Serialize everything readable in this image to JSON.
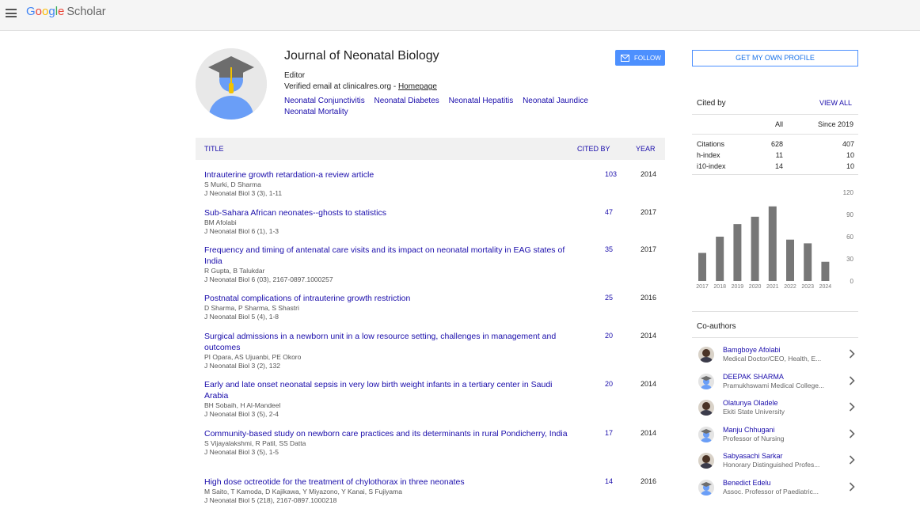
{
  "header": {
    "logo_google": "Google",
    "logo_scholar": "Scholar"
  },
  "profile": {
    "name": "Journal of Neonatal Biology",
    "affiliation": "Editor",
    "email": "Verified email at clinicalres.org - ",
    "homepage": "Homepage",
    "interests": [
      "Neonatal Conjunctivitis",
      "Neonatal Diabetes",
      "Neonatal Hepatitis",
      "Neonatal Jaundice",
      "Neonatal Mortality"
    ],
    "follow_label": "FOLLOW"
  },
  "table": {
    "col_title": "TITLE",
    "col_cited": "CITED BY",
    "col_year": "YEAR",
    "rows": [
      {
        "title": "Intrauterine growth retardation-a review article",
        "authors": "S Murki, D Sharma",
        "venue": "J Neonatal Biol 3 (3), 1-11",
        "cited": "103",
        "year": "2014"
      },
      {
        "title": "Sub-Sahara African neonates--ghosts to statistics",
        "authors": "BM Afolabi",
        "venue": "J Neonatal Biol 6 (1), 1-3",
        "cited": "47",
        "year": "2017"
      },
      {
        "title": "Frequency and timing of antenatal care visits and its impact on neonatal mortality in EAG states of India",
        "authors": "R Gupta, B Talukdar",
        "venue": "J Neonatal Biol 6 (03), 2167-0897.1000257",
        "cited": "35",
        "year": "2017"
      },
      {
        "title": "Postnatal complications of intrauterine growth restriction",
        "authors": "D Sharma, P Sharma, S Shastri",
        "venue": "J Neonatal Biol 5 (4), 1-8",
        "cited": "25",
        "year": "2016"
      },
      {
        "title": "Surgical admissions in a newborn unit in a low resource setting, challenges in management and outcomes",
        "authors": "PI Opara, AS Ujuanbi, PE Okoro",
        "venue": "J Neonatal Biol 3 (2), 132",
        "cited": "20",
        "year": "2014"
      },
      {
        "title": "Early and late onset neonatal sepsis in very low birth weight infants in a tertiary center in Saudi Arabia",
        "authors": "BH Sobaih, H Al-Mandeel",
        "venue": "J Neonatal Biol 3 (5), 2-4",
        "cited": "20",
        "year": "2014"
      },
      {
        "title": "Community-based study on newborn care practices and its determinants in rural Pondicherry, India",
        "authors": "S Vijayalakshmi, R Patil, SS Datta",
        "venue": "J Neonatal Biol 3 (5), 1-5",
        "cited": "17",
        "year": "2014"
      },
      {
        "title": "High dose octreotide for the treatment of chylothorax in three neonates",
        "authors": "M Saito, T Kamoda, D Kajikawa, Y Miyazono, Y Kanai, S Fujiyama",
        "venue": "J Neonatal Biol 5 (218), 2167-0897.1000218",
        "cited": "14",
        "year": "2016"
      }
    ]
  },
  "sidebar": {
    "own_profile_label": "GET MY OWN PROFILE",
    "cited_by": "Cited by",
    "view_all": "VIEW ALL",
    "col_all": "All",
    "col_since": "Since 2019",
    "stats": [
      {
        "label": "Citations",
        "all": "628",
        "since": "407"
      },
      {
        "label": "h-index",
        "all": "11",
        "since": "10"
      },
      {
        "label": "i10-index",
        "all": "14",
        "since": "10"
      }
    ],
    "coauthors_title": "Co-authors",
    "coauthors": [
      {
        "name": "Bamgboye Afolabi",
        "affil": "Medical Doctor/CEO, Health, E...",
        "photo": "dark"
      },
      {
        "name": "DEEPAK SHARMA",
        "affil": "Pramukhswami Medical College...",
        "photo": "default"
      },
      {
        "name": "Olatunya Oladele",
        "affil": "Ekiti State University",
        "photo": "dark"
      },
      {
        "name": "Manju Chhugani",
        "affil": "Professor of Nursing",
        "photo": "default"
      },
      {
        "name": "Sabyasachi Sarkar",
        "affil": "Honorary Distinguished Profes...",
        "photo": "dark"
      },
      {
        "name": "Benedict Edelu",
        "affil": "Assoc. Professor of Paediatric...",
        "photo": "default"
      }
    ]
  },
  "chart_data": {
    "type": "bar",
    "categories": [
      "2017",
      "2018",
      "2019",
      "2020",
      "2021",
      "2022",
      "2023",
      "2024"
    ],
    "values": [
      38,
      60,
      77,
      87,
      101,
      56,
      51,
      26
    ],
    "yticks": [
      "120",
      "90",
      "60",
      "30",
      "0"
    ],
    "ylim": [
      0,
      120
    ],
    "bar_color": "#777777"
  }
}
